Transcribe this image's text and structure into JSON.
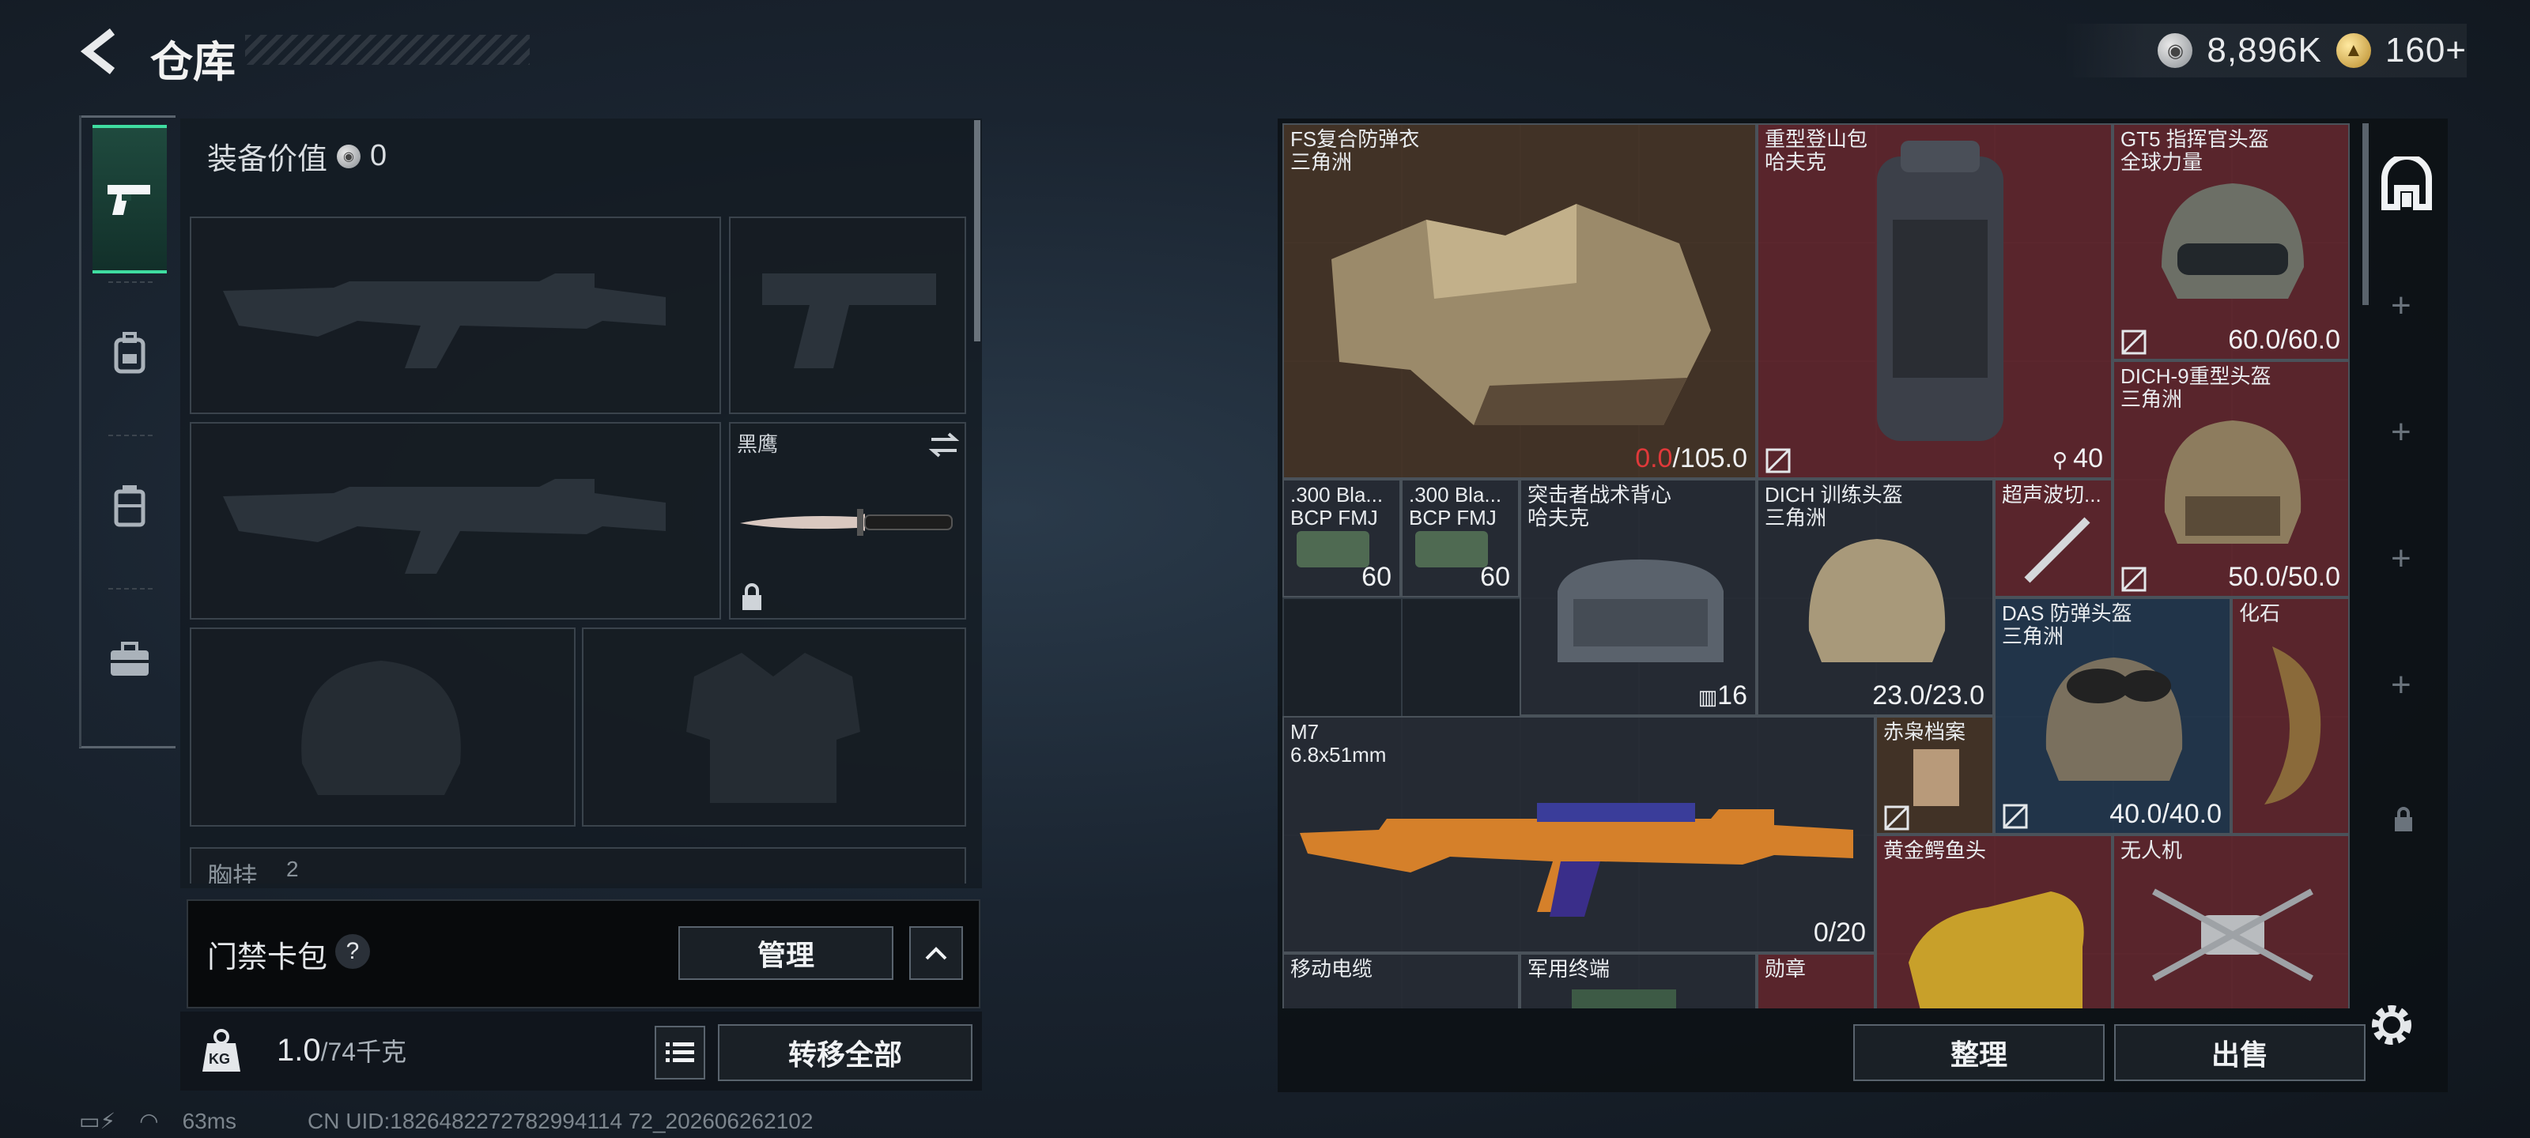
{
  "header": {
    "title": "仓库",
    "currencies": [
      {
        "icon": "silver-coin-icon",
        "value": "8,896K"
      },
      {
        "icon": "gold-coin-icon",
        "value": "160+"
      }
    ]
  },
  "sidenav": {
    "items": [
      {
        "icon": "pistol-icon",
        "active": true
      },
      {
        "icon": "backpack-icon",
        "active": false
      },
      {
        "icon": "chest-rig-icon",
        "active": false
      },
      {
        "icon": "briefcase-icon",
        "active": false
      }
    ]
  },
  "loadout": {
    "equip_value_label": "装备价值",
    "equip_value": "0",
    "knife_name": "黑鹰",
    "chest_label": "胸挂",
    "chest_count": "2",
    "cardpack_label": "门禁卡包",
    "help_label": "?",
    "manage_label": "管理",
    "weight_icon_label": "KG",
    "weight_value": "1.0",
    "weight_unit": "/74千克",
    "transfer_all_label": "转移全部"
  },
  "stash": {
    "items": [
      {
        "name": "FS复合防弹衣",
        "sub": "三角洲",
        "value_bad": "0.0",
        "value": "/105.0"
      },
      {
        "name": "重型登山包",
        "sub": "哈夫克",
        "count": "40"
      },
      {
        "name": "GT5 指挥官头盔",
        "sub": "全球力量",
        "value": "60.0/60.0"
      },
      {
        "name": "DICH-9重型头盔",
        "sub": "三角洲",
        "value": "50.0/50.0"
      },
      {
        "name": ".300 Bla...",
        "sub": "BCP FMJ",
        "value": "60"
      },
      {
        "name": ".300 Bla...",
        "sub": "BCP FMJ",
        "value": "60"
      },
      {
        "name": "突击者战术背心",
        "sub": "哈夫克",
        "value": "16"
      },
      {
        "name": "DICH 训练头盔",
        "sub": "三角洲",
        "value": "23.0/23.0"
      },
      {
        "name": "超声波切...",
        "sub": ""
      },
      {
        "name": "DAS 防弹头盔",
        "sub": "三角洲",
        "value": "40.0/40.0"
      },
      {
        "name": "化石",
        "sub": ""
      },
      {
        "name": "M7",
        "sub": "6.8x51mm",
        "value": "0/20"
      },
      {
        "name": "赤枭档案",
        "sub": ""
      },
      {
        "name": "黄金鳄鱼头",
        "sub": ""
      },
      {
        "name": "无人机",
        "sub": ""
      },
      {
        "name": "移动电缆",
        "sub": ""
      },
      {
        "name": "军用终端",
        "sub": ""
      },
      {
        "name": "勋章",
        "sub": ""
      }
    ],
    "organize_label": "整理",
    "sell_label": "出售"
  },
  "status": {
    "ping": "63ms",
    "uid": "CN UID:1826482272782994114 72_202606262102"
  },
  "colors": {
    "accent_green": "#3fdca0",
    "damage_red": "#e0393a",
    "item_red_bg": "#60262c",
    "item_blue_bg": "#22364c"
  }
}
